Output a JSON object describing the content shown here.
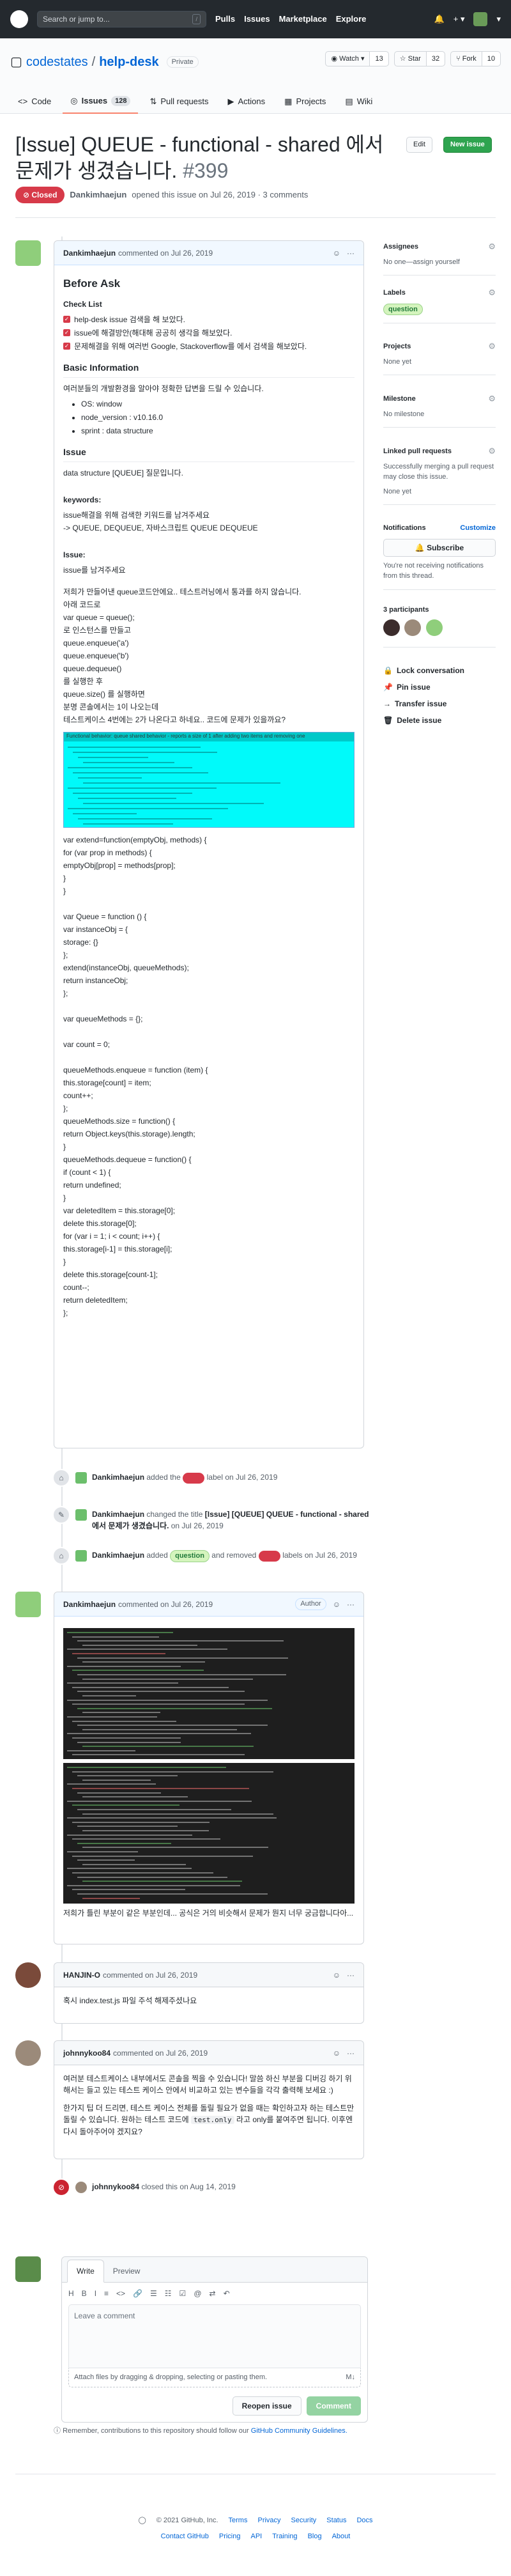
{
  "header": {
    "search_placeholder": "Search or jump to...",
    "search_key": "/",
    "nav": [
      "Pulls",
      "Issues",
      "Marketplace",
      "Explore"
    ],
    "icons": [
      "bell-icon",
      "plus-icon",
      "avatar"
    ]
  },
  "repo": {
    "owner": "codestates",
    "sep": "/",
    "name": "help-desk",
    "visibility": "Private",
    "watch_label": "Watch",
    "watch_count": "13",
    "star_label": "Star",
    "star_count": "32",
    "fork_label": "Fork",
    "fork_count": "10",
    "tabs": [
      {
        "label": "Code"
      },
      {
        "label": "Issues",
        "count": "128"
      },
      {
        "label": "Pull requests"
      },
      {
        "label": "Actions"
      },
      {
        "label": "Projects"
      },
      {
        "label": "Wiki"
      }
    ]
  },
  "issue": {
    "title": "[Issue] QUEUE - functional - shared 에서 문제가 생겼습니다.",
    "number": "#399",
    "edit_label": "Edit",
    "new_label": "New issue",
    "state": "Closed",
    "author": "Dankimhaejun",
    "opened_text": "opened this issue on Jul 26, 2019 · 3 comments"
  },
  "comments": [
    {
      "author": "Dankimhaejun",
      "meta": "commented on Jul 26, 2019",
      "heading": "Before Ask",
      "checklist_title": "Check List",
      "checklist": [
        "help-desk issue 검색을 해 보았다.",
        "issue에 해결방안(해대해 공공히 생각을 해보았다.",
        "문제해결을 위해 여러번 Google, Stackoverflow를 에서 검색을 해보았다."
      ],
      "basic_title": "Basic Information",
      "basic_intro": "여러분들의 개발환경을 알아야 정확한 답변을 드릴 수 있습니다.",
      "basic_list": [
        "OS: window",
        "node_version : v10.16.0",
        "sprint : data structure"
      ],
      "issue_title": "Issue",
      "issue_text": "data structure [QUEUE] 질문입니다.",
      "keywords_title": "keywords:",
      "keywords_lines": [
        "issue해결을 위해 검색한 키워드를 남겨주세요",
        "-> QUEUE, DEQUEUE, 자바스크립트 QUEUE DEQUEUE"
      ],
      "issue2_title": "Issue:",
      "issue2_text": "issue를 남겨주세요",
      "desc_lines": [
        "저희가 만들어낸 queue코드안에요.. 테스트러닝에서 통과를 하지 않습니다.",
        "아래 코드로",
        "var queue = queue();",
        "로 인스턴스를 만들고",
        "queue.enqueue('a')",
        "queue.enqueue('b')",
        "queue.dequeue()",
        "를 실행한 후",
        "queue.size() 를 실행하면",
        "분명 콘솔에서는 1이 나오는데",
        "테스트케이스 4번에는 2가 나온다고 하네요.. 코드에 문제가 있을까요?"
      ],
      "cyan_caption": "Functional behavior: queue shared behavior - reports a size of 1 after adding two items and removing one",
      "code_lines": [
        "var extend=function(emptyObj, methods) {",
        "for (var prop in methods) {",
        "emptyObj[prop] = methods[prop];",
        "}",
        "}",
        "",
        "var Queue = function () {",
        "var instanceObj = {",
        "storage: {}",
        "};",
        "extend(instanceObj, queueMethods);",
        "return instanceObj;",
        "};",
        "",
        "var queueMethods = {};",
        "",
        "var count = 0;",
        "",
        "queueMethods.enqueue = function (item) {",
        "this.storage[count] = item;",
        "count++;",
        "};",
        "queueMethods.size = function() {",
        "return Object.keys(this.storage).length;",
        "}",
        "queueMethods.dequeue = function() {",
        "if (count < 1) {",
        "return undefined;",
        "}",
        "var deletedItem = this.storage[0];",
        "delete this.storage[0];",
        "for (var i = 1; i < count; i++) {",
        "this.storage[i-1] = this.storage[i];",
        "}",
        "delete this.storage[count-1];",
        "count--;",
        "return deletedItem;",
        "};"
      ]
    },
    {
      "author": "Dankimhaejun",
      "meta": "commented on Jul 26, 2019",
      "badge": "Author",
      "text": "저희가 틀린 부분이 같은 부분인데... 공식은 거의 비슷해서 문제가 뭔지 너무 궁금합니다아..."
    },
    {
      "author": "HANJIN-O",
      "meta": "commented on Jul 26, 2019",
      "text": "혹시 index.test.js 파일 주석 해제주셨나요"
    },
    {
      "author": "johnnykoo84",
      "meta": "commented on Jul 26, 2019",
      "p1": "여러분 테스트케이스 내부에서도 콘솔을 찍을 수 있습니다! 말씀 하신 부분을 디버깅 하기 위해서는 들고 있는 테스트 케이스 안에서 비교하고 있는 변수들을 각각 출력해 보세요 :)",
      "p2_a": "한가지 팁 더 드리면, 테스트 케이스 전체를 돌릴 필요가 없을 때는 확인하고자 하는 테스트만 돌릴 수 있습니다. 원하는 테스트 코드에 ",
      "p2_code": "test.only",
      "p2_b": " 라고 only를 붙여주면 됩니다. 이후엔 다시 돌아주어야 겠지요?"
    }
  ],
  "events": [
    {
      "author": "Dankimhaejun",
      "pre": "added the",
      "label": "bug",
      "post": "label on Jul 26, 2019"
    },
    {
      "author": "Dankimhaejun",
      "pre": "changed the title",
      "title": "[Issue] [QUEUE] QUEUE - functional - shared 에서 문제가 생겼습니다.",
      "post": "on Jul 26, 2019"
    },
    {
      "author": "Dankimhaejun",
      "pre": "added",
      "label_added": "question",
      "mid": "and removed",
      "label_removed": "bug",
      "post": "labels on Jul 26, 2019"
    },
    {
      "author": "johnnykoo84",
      "text": "closed this on Aug 14, 2019"
    }
  ],
  "sidebar": {
    "assignees_title": "Assignees",
    "assignees_value": "No one—assign yourself",
    "labels_title": "Labels",
    "label": "question",
    "projects_title": "Projects",
    "projects_value": "None yet",
    "milestone_title": "Milestone",
    "milestone_value": "No milestone",
    "linked_title": "Linked pull requests",
    "linked_value": "Successfully merging a pull request may close this issue.",
    "linked_none": "None yet",
    "notifications_title": "Notifications",
    "customize": "Customize",
    "subscribe": "Subscribe",
    "notif_text": "You're not receiving notifications from this thread.",
    "participants_title": "3 participants",
    "actions": [
      "Lock conversation",
      "Pin issue",
      "Transfer issue",
      "Delete issue"
    ]
  },
  "editor": {
    "tab_write": "Write",
    "tab_preview": "Preview",
    "tools": [
      "H",
      "B",
      "I",
      "≡",
      "<>",
      "🔗",
      "☰",
      "☷",
      "☑",
      "@",
      "⇄",
      "↶"
    ],
    "placeholder": "Leave a comment",
    "attach": "Attach files by dragging & dropping, selecting or pasting them.",
    "reopen": "Reopen issue",
    "comment": "Comment",
    "note_pre": "Remember, contributions to this repository should follow our",
    "note_link": "GitHub Community Guidelines."
  },
  "footer": {
    "copyright": "© 2021 GitHub, Inc.",
    "row1": [
      "Terms",
      "Privacy",
      "Security",
      "Status",
      "Docs"
    ],
    "row2": [
      "Contact GitHub",
      "Pricing",
      "API",
      "Training",
      "Blog",
      "About"
    ]
  }
}
